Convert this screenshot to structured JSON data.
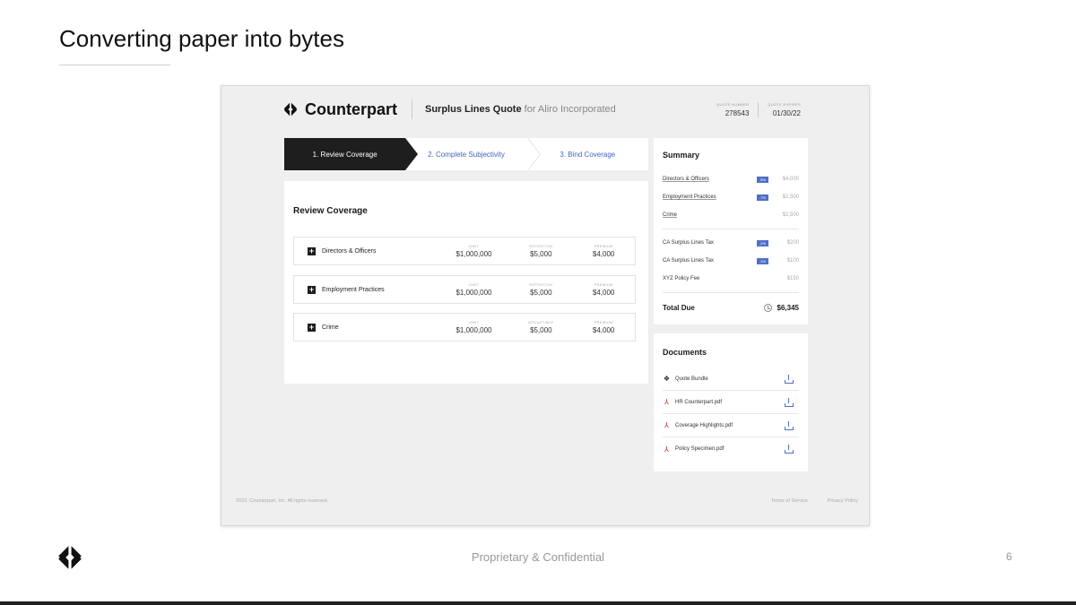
{
  "slide": {
    "title": "Converting paper into bytes",
    "footer": "Proprietary & Confidential",
    "page_number": "6"
  },
  "app": {
    "brand": "Counterpart",
    "quote_title": "Surplus Lines Quote",
    "quote_for": "for Aliro Incorporated",
    "quote_number_label": "QUOTE NUMBER",
    "quote_number": "278543",
    "quote_expires_label": "QUOTE EXPIRES",
    "quote_expires": "01/30/22",
    "steps": [
      {
        "label": "1. Review Coverage"
      },
      {
        "label": "2. Complete Subjectivity"
      },
      {
        "label": "3. Bind Coverage"
      }
    ],
    "review": {
      "title": "Review Coverage",
      "rows": [
        {
          "name": "Directors & Officers",
          "limit_label": "LIMIT",
          "limit": "$1,000,000",
          "mid_label": "RETENTION",
          "mid": "$5,000",
          "premium_label": "PREMIUM",
          "premium": "$4,000"
        },
        {
          "name": "Employment Practices",
          "limit_label": "LIMIT",
          "limit": "$1,000,000",
          "mid_label": "RETENTION",
          "mid": "$5,000",
          "premium_label": "PREMIUM",
          "premium": "$4,000"
        },
        {
          "name": "Crime",
          "limit_label": "LIMIT",
          "limit": "$1,000,000",
          "mid_label": "DEDUCTIBLE",
          "mid": "$5,000",
          "premium_label": "PREMIUM",
          "premium": "$4,000"
        }
      ]
    },
    "summary": {
      "title": "Summary",
      "lines": [
        {
          "name": "Directors & Officers",
          "pct": "-5%",
          "amount": "$4,000"
        },
        {
          "name": "Employment Practices",
          "pct": "-7%",
          "amount": "$2,500"
        },
        {
          "name": "Crime",
          "pct": "",
          "amount": "$2,500"
        }
      ],
      "taxes": [
        {
          "name": "CA Surplus Lines Tax",
          "pct": "-2%",
          "amount": "$200"
        },
        {
          "name": "CA Surplus Lines Tax",
          "pct": "-1%",
          "amount": "$100"
        },
        {
          "name": "XYZ Policy Fee",
          "pct": "",
          "amount": "$150"
        }
      ],
      "total_label": "Total Due",
      "total": "$6,345"
    },
    "documents": {
      "title": "Documents",
      "items": [
        {
          "name": "Quote Bundle",
          "icon": "counterpart-icon"
        },
        {
          "name": "HR Counterpart.pdf",
          "icon": "pdf-icon"
        },
        {
          "name": "Coverage Highlights.pdf",
          "icon": "pdf-icon"
        },
        {
          "name": "Policy Specimen.pdf",
          "icon": "pdf-icon"
        }
      ]
    },
    "footer": {
      "copyright": "2022, Counterpart, Inc. All rights reserved.",
      "terms": "Terms of Service",
      "privacy": "Privacy Policy"
    }
  }
}
